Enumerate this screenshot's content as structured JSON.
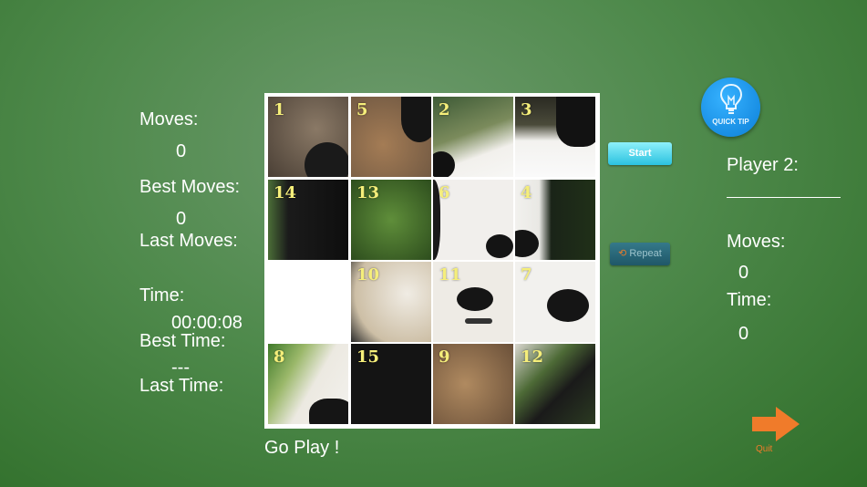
{
  "left_panel": {
    "moves_label": "Moves:",
    "moves_value": "0",
    "best_moves_label": "Best Moves:",
    "best_moves_value": "0",
    "last_moves_label": "Last Moves:",
    "time_label": "Time:",
    "time_value": "00:00:08",
    "best_time_label": "Best Time:",
    "best_time_value": "---",
    "last_time_label": "Last Time:"
  },
  "board": {
    "tiles": [
      "1",
      "5",
      "2",
      "3",
      "14",
      "13",
      "6",
      "4",
      "",
      "10",
      "11",
      "7",
      "8",
      "15",
      "9",
      "12"
    ]
  },
  "footer": {
    "status": "Go Play !"
  },
  "controls": {
    "start_label": "Start",
    "repeat_label": "Repeat",
    "quick_tip_label": "QUICK TIP",
    "quit_label": "Quit"
  },
  "right_panel": {
    "player_label": "Player 2:",
    "moves_label": "Moves:",
    "moves_value": "0",
    "time_label": "Time:",
    "time_value": "0"
  },
  "colors": {
    "tile_number": "#f5ee7a",
    "start_button": "#2bc2df",
    "repeat_button": "#1f5768",
    "quit_arrow": "#f07b2a"
  }
}
